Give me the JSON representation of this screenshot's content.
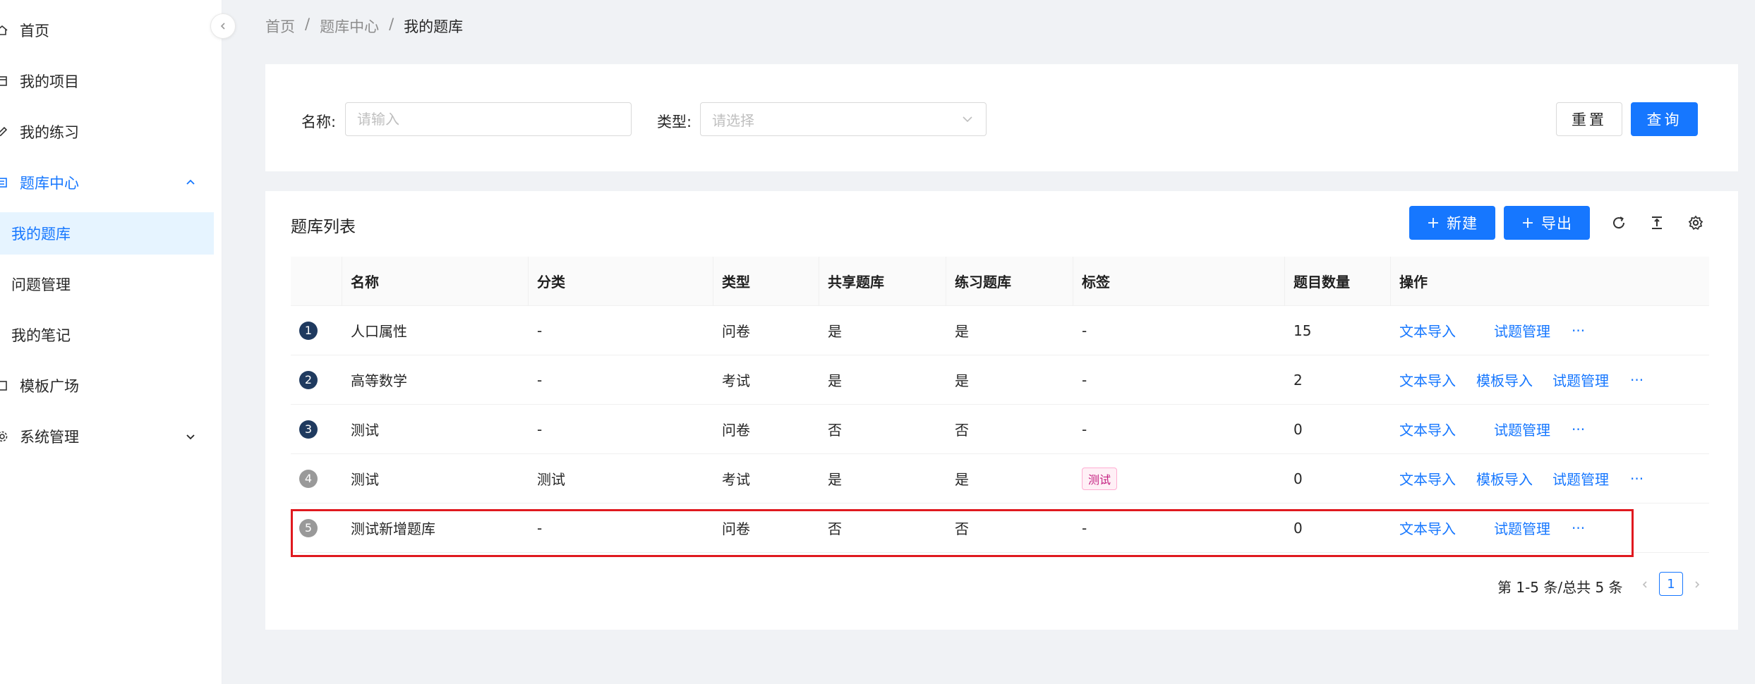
{
  "sidebar": {
    "items": [
      {
        "label": "首页",
        "icon": "home-icon"
      },
      {
        "label": "我的项目",
        "icon": "project-icon"
      },
      {
        "label": "我的练习",
        "icon": "edit-icon"
      },
      {
        "label": "题库中心",
        "icon": "list-icon",
        "expanded": true
      },
      {
        "label": "我的题库",
        "selected": true
      },
      {
        "label": "问题管理"
      },
      {
        "label": "我的笔记"
      },
      {
        "label": "模板广场",
        "icon": "template-icon"
      },
      {
        "label": "系统管理",
        "icon": "gear-icon",
        "expanded": false
      }
    ]
  },
  "breadcrumb": {
    "items": [
      "首页",
      "题库中心",
      "我的题库"
    ],
    "separator": "/"
  },
  "search": {
    "name_label": "名称:",
    "name_placeholder": "请输入",
    "type_label": "类型:",
    "type_placeholder": "请选择",
    "reset_label": "重置",
    "query_label": "查询"
  },
  "table_card": {
    "title": "题库列表",
    "new_label": "新建",
    "export_label": "导出",
    "columns": [
      "名称",
      "分类",
      "类型",
      "共享题库",
      "练习题库",
      "标签",
      "题目数量",
      "操作"
    ],
    "rows": [
      {
        "index": "1",
        "name": "人口属性",
        "category": "-",
        "type": "问卷",
        "shared": "是",
        "practice": "是",
        "tag": "-",
        "count": "15",
        "actions": [
          "文本导入",
          "试题管理"
        ]
      },
      {
        "index": "2",
        "name": "高等数学",
        "category": "-",
        "type": "考试",
        "shared": "是",
        "practice": "是",
        "tag": "-",
        "count": "2",
        "actions": [
          "文本导入",
          "模板导入",
          "试题管理"
        ]
      },
      {
        "index": "3",
        "name": "测试",
        "category": "-",
        "type": "问卷",
        "shared": "否",
        "practice": "否",
        "tag": "-",
        "count": "0",
        "actions": [
          "文本导入",
          "试题管理"
        ]
      },
      {
        "index": "4",
        "name": "测试",
        "category": "测试",
        "type": "考试",
        "shared": "是",
        "practice": "是",
        "tag": "测试",
        "count": "0",
        "actions": [
          "文本导入",
          "模板导入",
          "试题管理"
        ]
      },
      {
        "index": "5",
        "name": "测试新增题库",
        "category": "-",
        "type": "问卷",
        "shared": "否",
        "practice": "否",
        "tag": "-",
        "count": "0",
        "actions": [
          "文本导入",
          "试题管理"
        ]
      }
    ],
    "more_label": "···"
  },
  "pagination": {
    "total_text": "第 1-5 条/总共 5 条",
    "current_page": "1"
  },
  "colors": {
    "primary": "#1677ff",
    "highlight": "#e0191f",
    "tag_text": "#c41d7f"
  }
}
